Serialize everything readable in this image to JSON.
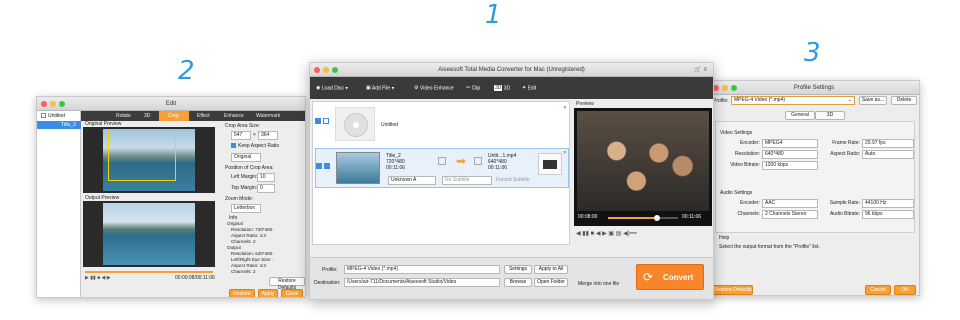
{
  "steps": {
    "one": "1",
    "two": "2",
    "three": "3"
  },
  "main": {
    "title": "Aiseesoft Total Media Converter for Mac (Unregistered)",
    "toolbar": {
      "load_disc": "Load Disc",
      "add_file": "Add File",
      "video_enhance": "Video Enhance",
      "clip": "Clip",
      "three_d": "3D",
      "edit": "Edit"
    },
    "disc_item": {
      "title": "Untitled"
    },
    "file_item": {
      "name": "Title_2",
      "resolution": "720*480",
      "duration": "00:11:06",
      "out_name": "Untit...1.mp4",
      "out_resolution": "640*480",
      "out_duration": "00:11:06",
      "audio": "Unknown A",
      "subtitle": "No Subtitle",
      "forced": "Forced Subtitle"
    },
    "preview_label": "Preview",
    "time_current": "00:08:00",
    "time_total": "00:11:06",
    "profile_label": "Profile:",
    "profile_value": "MPEG-4 Video (*.mp4)",
    "settings_btn": "Settings",
    "apply_all_btn": "Apply to All",
    "destination_label": "Destination:",
    "destination_value": "/Users/air-711/Documents/Aiseesoft Studio/Video",
    "browse_btn": "Browse",
    "open_folder_btn": "Open Folder",
    "merge_label": "Merge into one file",
    "convert_btn": "Convert"
  },
  "edit": {
    "title": "Edit",
    "tree_root": "Untitled",
    "tree_item": "Title_3",
    "tabs": [
      "Rotate",
      "3D",
      "Crop",
      "Effect",
      "Enhance",
      "Watermark"
    ],
    "active_tab": "Crop",
    "original_preview": "Original Preview",
    "output_preview": "Output Preview",
    "crop_area_size": "Crop Area Size:",
    "crop_w": "547",
    "crop_h": "364",
    "keep_aspect": "Keep Aspect Ratio",
    "aspect_select": "Original",
    "position_label": "Position of Crop Area:",
    "left_margin": "Left Margin:",
    "left_value": "10",
    "top_margin": "Top Margin:",
    "top_value": "0",
    "zoom_mode": "Zoom Mode:",
    "zoom_value": "Letterbox",
    "info_label": "Info",
    "info_lines": [
      "Original",
      "Resolution: 720*480",
      "Aspect Ratio: 4:3",
      "Channels: 2",
      "Output",
      "Resolution: 640*480",
      "Left/Right Eye Size: -",
      "Aspect Ratio: 4:3",
      "Channels: 2"
    ],
    "time": "00:00:08/00:11:06",
    "restore_defaults": "Restore Defaults",
    "restore_all": "Restore All",
    "apply": "Apply",
    "close": "Close"
  },
  "profile": {
    "title": "Profile Settings",
    "profile_label": "Profile:",
    "profile_value": "MPEG-4 Video (*.mp4)",
    "save_as": "Save as...",
    "delete": "Delete",
    "tabs": [
      "General",
      "3D"
    ],
    "video_settings": "Video Settings",
    "encoder_label": "Encoder:",
    "encoder_value": "MPEG4",
    "frame_rate_label": "Frame Rate:",
    "frame_rate_value": "29.97 fps",
    "resolution_label": "Resolution:",
    "resolution_value": "640*480",
    "aspect_label": "Aspect Ratio:",
    "aspect_value": "Auto",
    "video_bitrate_label": "Video Bitrate:",
    "video_bitrate_value": "1200 kbps",
    "audio_settings": "Audio Settings",
    "a_encoder_label": "Encoder:",
    "a_encoder_value": "AAC",
    "sample_rate_label": "Sample Rate:",
    "sample_rate_value": "44100 Hz",
    "channels_label": "Channels:",
    "channels_value": "2 Channels Stereo",
    "audio_bitrate_label": "Audio Bitrate:",
    "audio_bitrate_value": "96 kbps",
    "help_label": "Help",
    "help_text": "Select the output format from the \"Profile\" list.",
    "restore_defaults": "Restore Defaults",
    "cancel": "Cancel",
    "ok": "OK"
  },
  "colors": {
    "accent": "#2c9be0",
    "orange": "#f7a035",
    "selection": "#3a8ee6"
  }
}
